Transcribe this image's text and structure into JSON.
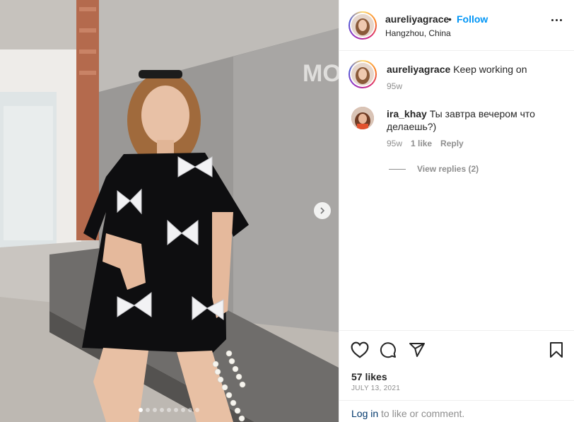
{
  "post": {
    "username": "aureliyagrace",
    "separator": "•",
    "follow_label": "Follow",
    "location": "Hangzhou, China",
    "more_icon": "more-horizontal-icon",
    "photo_overlay_text": "MO GA",
    "carousel": {
      "total_slides": 9,
      "active_index": 0,
      "next_icon": "chevron-right-icon"
    }
  },
  "caption": {
    "username": "aureliyagrace",
    "text": "Keep working on",
    "time": "95w"
  },
  "comments": [
    {
      "username": "ira_khay",
      "text": "Ты завтра вечером что делаешь?)",
      "time": "95w",
      "likes": "1 like",
      "reply_label": "Reply",
      "view_replies": "View replies (2)"
    }
  ],
  "actions": {
    "like_icon": "heart-icon",
    "comment_icon": "comment-icon",
    "share_icon": "share-icon",
    "save_icon": "bookmark-icon",
    "likes": "57 likes",
    "date": "JULY 13, 2021"
  },
  "footer": {
    "login_label": "Log in",
    "rest": " to like or comment."
  },
  "colors": {
    "link": "#0095f6",
    "text": "#262626",
    "muted": "#8e8e8e"
  }
}
